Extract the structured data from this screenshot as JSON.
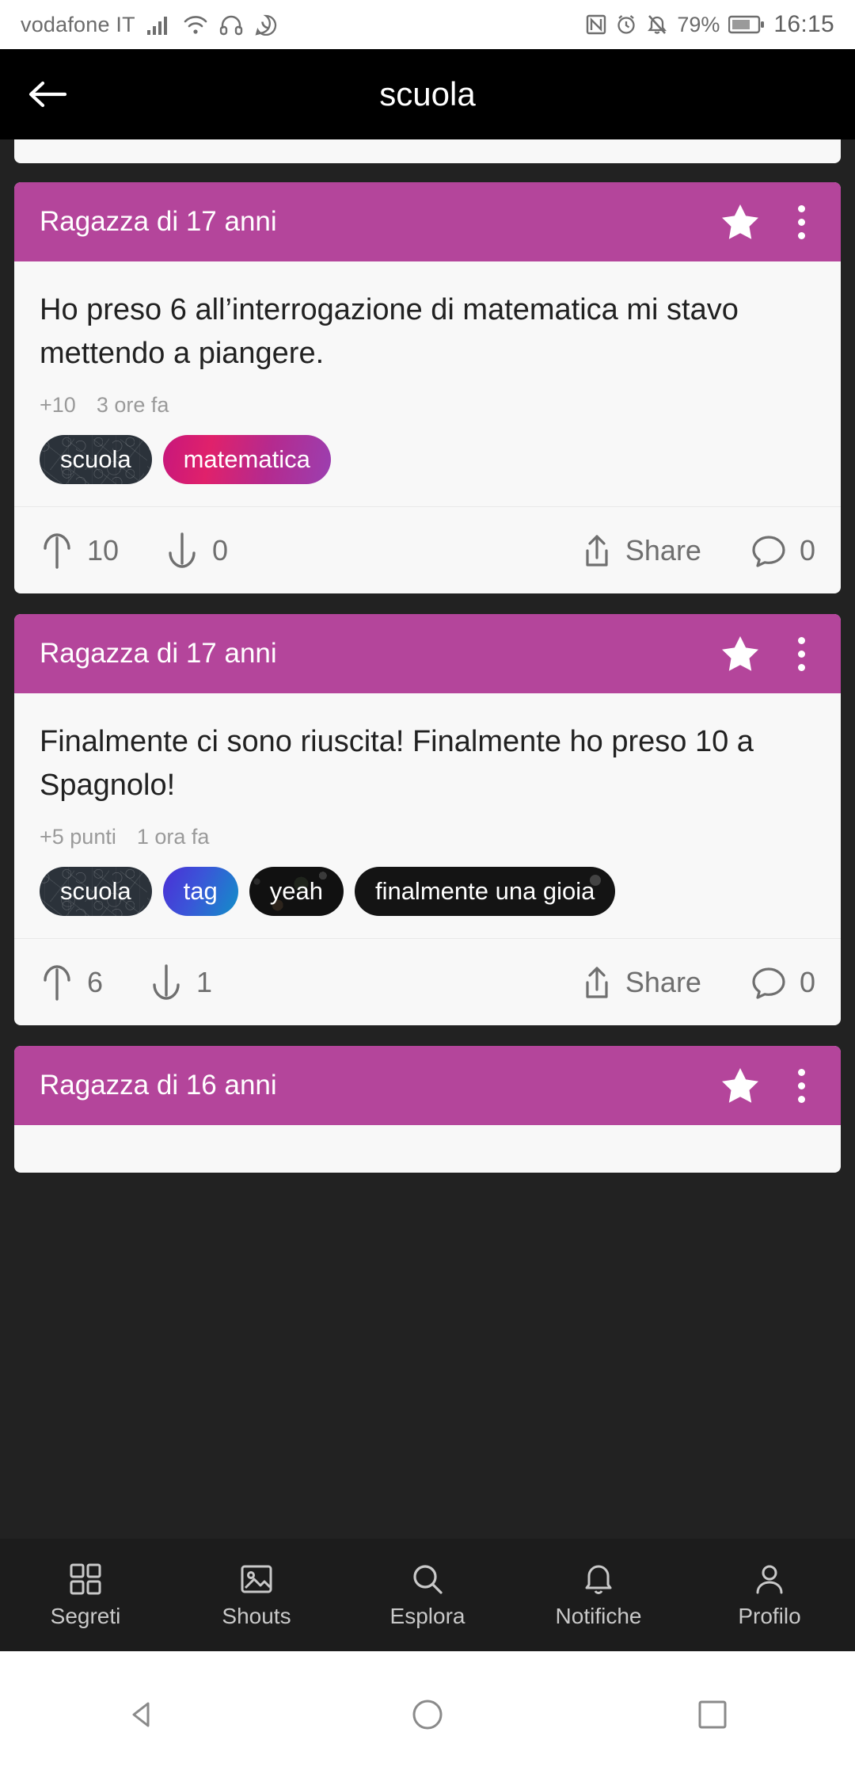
{
  "statusbar": {
    "carrier": "vodafone IT",
    "battery_percent": "79%",
    "time": "16:15",
    "icons": [
      "signal-icon",
      "wifi-icon",
      "headphones-icon",
      "whatsapp-icon",
      "nfc-icon",
      "alarm-icon",
      "mute-icon",
      "battery-icon"
    ]
  },
  "appbar": {
    "back_icon": "back-arrow-icon",
    "title": "scuola"
  },
  "posts": [
    {
      "author": "Ragazza di 17 anni",
      "text": "Ho preso 6 all’interrogazione di matematica mi stavo mettendo a piangere.",
      "points": "+10",
      "time": "3 ore fa",
      "tags": [
        {
          "label": "scuola",
          "style": "doodle"
        },
        {
          "label": "matematica",
          "style": "magenta"
        }
      ],
      "upvotes": "10",
      "downvotes": "0",
      "share_label": "Share",
      "comments": "0"
    },
    {
      "author": "Ragazza di 17 anni",
      "text": "Finalmente ci sono riuscita! Finalmente ho preso 10 a Spagnolo!",
      "points": "+5 punti",
      "time": "1 ora fa",
      "tags": [
        {
          "label": "scuola",
          "style": "doodle"
        },
        {
          "label": "tag",
          "style": "blue"
        },
        {
          "label": "yeah",
          "style": "dark2"
        },
        {
          "label": "finalmente una gioia",
          "style": "plain-dark"
        }
      ],
      "upvotes": "6",
      "downvotes": "1",
      "share_label": "Share",
      "comments": "0"
    },
    {
      "author": "Ragazza di 16 anni",
      "text": "",
      "points": "",
      "time": "",
      "tags": [],
      "upvotes": "",
      "downvotes": "",
      "share_label": "",
      "comments": ""
    }
  ],
  "bottomnav": {
    "items": [
      {
        "label": "Segreti",
        "icon": "grid-icon"
      },
      {
        "label": "Shouts",
        "icon": "image-icon"
      },
      {
        "label": "Esplora",
        "icon": "search-icon"
      },
      {
        "label": "Notifiche",
        "icon": "bell-icon"
      },
      {
        "label": "Profilo",
        "icon": "person-icon"
      }
    ]
  },
  "sysnav": {
    "back": "system-back-icon",
    "home": "system-home-icon",
    "recents": "system-recents-icon"
  },
  "colors": {
    "header_pink": "#b4459b",
    "app_bar": "#000000",
    "feed_background": "#222222",
    "card_background": "#f8f8f8",
    "nav_background": "#1c1c1c"
  }
}
